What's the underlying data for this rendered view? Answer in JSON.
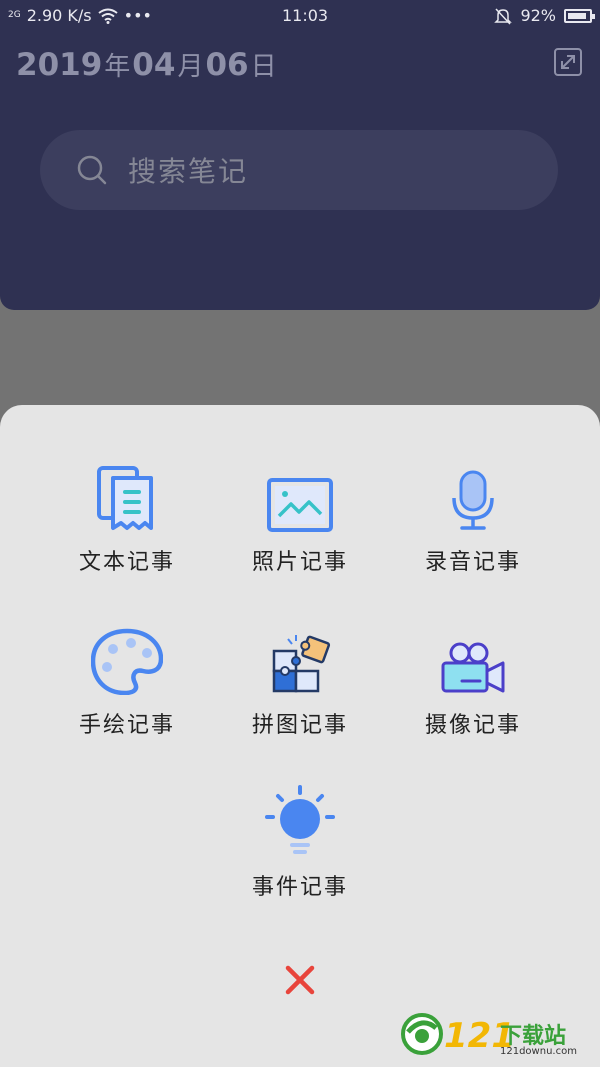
{
  "status": {
    "net_type": "2G",
    "speed": "2.90 K/s",
    "more": "•••",
    "time": "11:03",
    "battery": "92%",
    "battery_level": 0.92
  },
  "header": {
    "year": "2019",
    "year_unit": "年",
    "month": "04",
    "month_unit": "月",
    "day": "06",
    "day_unit": "日",
    "expand_icon": "expand-icon"
  },
  "search": {
    "placeholder": "搜索笔记"
  },
  "menu": {
    "items": [
      {
        "label": "文本记事",
        "icon": "text-note-icon"
      },
      {
        "label": "照片记事",
        "icon": "photo-note-icon"
      },
      {
        "label": "录音记事",
        "icon": "voice-note-icon"
      },
      {
        "label": "手绘记事",
        "icon": "drawing-note-icon"
      },
      {
        "label": "拼图记事",
        "icon": "puzzle-note-icon"
      },
      {
        "label": "摄像记事",
        "icon": "video-note-icon"
      },
      {
        "label": "事件记事",
        "icon": "event-note-icon"
      }
    ],
    "close_icon": "close-icon"
  },
  "watermark": {
    "number": "121",
    "text": "下载站",
    "url": "121downu.com"
  },
  "colors": {
    "header_bg": "#2f3152",
    "sheet_bg": "#e5e5e5",
    "accent_blue": "#4a86f0",
    "close_red": "#e8453c"
  }
}
